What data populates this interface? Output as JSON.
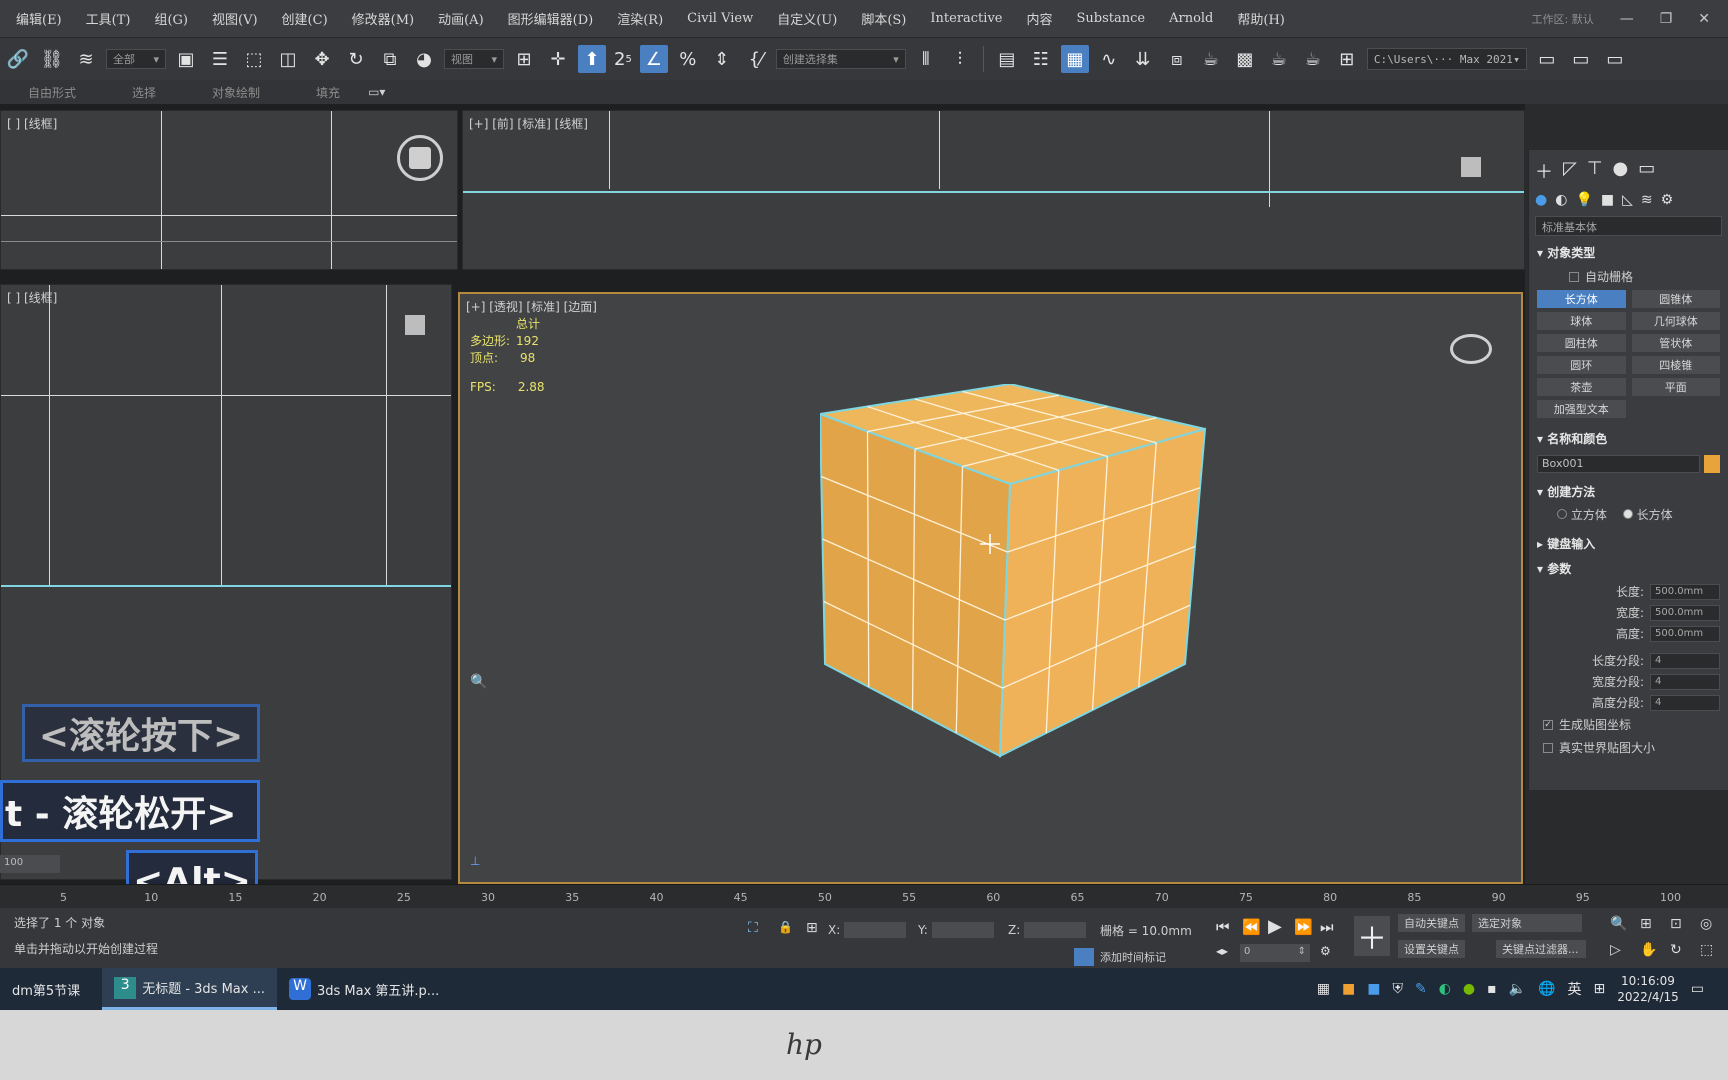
{
  "menubar": {
    "items": [
      "编辑(E)",
      "工具(T)",
      "组(G)",
      "视图(V)",
      "创建(C)",
      "修改器(M)",
      "动画(A)",
      "图形编辑器(D)",
      "渲染(R)",
      "Civil View",
      "自定义(U)",
      "脚本(S)",
      "Interactive",
      "内容",
      "Substance",
      "Arnold",
      "帮助(H)"
    ],
    "workspace_label": "工作区: 默认"
  },
  "toolbar": {
    "filter_select": "全部",
    "view_select": "视图",
    "selection_set": "创建选择集",
    "project_path": "C:\\Users\\··· Max 2021",
    "snap_label": "2",
    "snap_sub": "5"
  },
  "ribbon": {
    "labels": [
      "自由形式",
      "选择",
      "对象绘制",
      "填充"
    ]
  },
  "viewports": {
    "top_left_label": "[ ] [线框]",
    "front_label": "[+] [前] [标准] [线框]",
    "left_label": "[ ] [线框]",
    "persp_label": "[+] [透视] [标准] [边面]",
    "stats": {
      "total_label": "总计",
      "poly_label": "多边形:",
      "poly_value": "192",
      "vert_label": "顶点:",
      "vert_value": "98",
      "fps_label": "FPS:",
      "fps_value": "2.88"
    }
  },
  "overlays": {
    "wheel_down": "<滚轮按下>",
    "wheel_up": "t - 滚轮松开>",
    "alt_key": "<Alt>"
  },
  "command_panel": {
    "category_dropdown": "标准基本体",
    "object_type_title": "对象类型",
    "autogrid_label": "自动栅格",
    "object_buttons": [
      "长方体",
      "圆锥体",
      "球体",
      "几何球体",
      "圆柱体",
      "管状体",
      "圆环",
      "四棱锥",
      "茶壶",
      "平面",
      "加强型文本"
    ],
    "name_color_title": "名称和颜色",
    "object_name": "Box001",
    "object_color": "#e8a33a",
    "creation_method_title": "创建方法",
    "creation_cube": "立方体",
    "creation_box": "长方体",
    "keyboard_entry_title": "键盘输入",
    "params_title": "参数",
    "params": [
      {
        "label": "长度:",
        "value": "500.0mm"
      },
      {
        "label": "宽度:",
        "value": "500.0mm"
      },
      {
        "label": "高度:",
        "value": "500.0mm"
      }
    ],
    "segments": [
      {
        "label": "长度分段:",
        "value": "4"
      },
      {
        "label": "宽度分段:",
        "value": "4"
      },
      {
        "label": "高度分段:",
        "value": "4"
      }
    ],
    "gen_mapping": "生成贴图坐标",
    "real_world": "真实世界贴图大小"
  },
  "timeline": {
    "frame_field": "100",
    "ticks": [
      "5",
      "10",
      "15",
      "20",
      "25",
      "30",
      "35",
      "40",
      "45",
      "50",
      "55",
      "60",
      "65",
      "70",
      "75",
      "80",
      "85",
      "90",
      "95",
      "100"
    ]
  },
  "status": {
    "selected": "选择了 1 个 对象",
    "hint": "单击并拖动以开始创建过程",
    "x_label": "X:",
    "y_label": "Y:",
    "z_label": "Z:",
    "grid": "栅格 = 10.0mm",
    "add_time_tag": "添加时间标记",
    "frame_value": "0",
    "auto_key": "自动关键点",
    "selected_obj": "选定对象",
    "set_key": "设置关键点",
    "key_filter": "关键点过滤器..."
  },
  "taskbar": {
    "items": [
      "dm第5节课",
      "无标题 - 3ds Max ...",
      "3ds Max 第五讲.p..."
    ],
    "ime": "英",
    "time": "10:16:09",
    "date": "2022/4/15"
  }
}
